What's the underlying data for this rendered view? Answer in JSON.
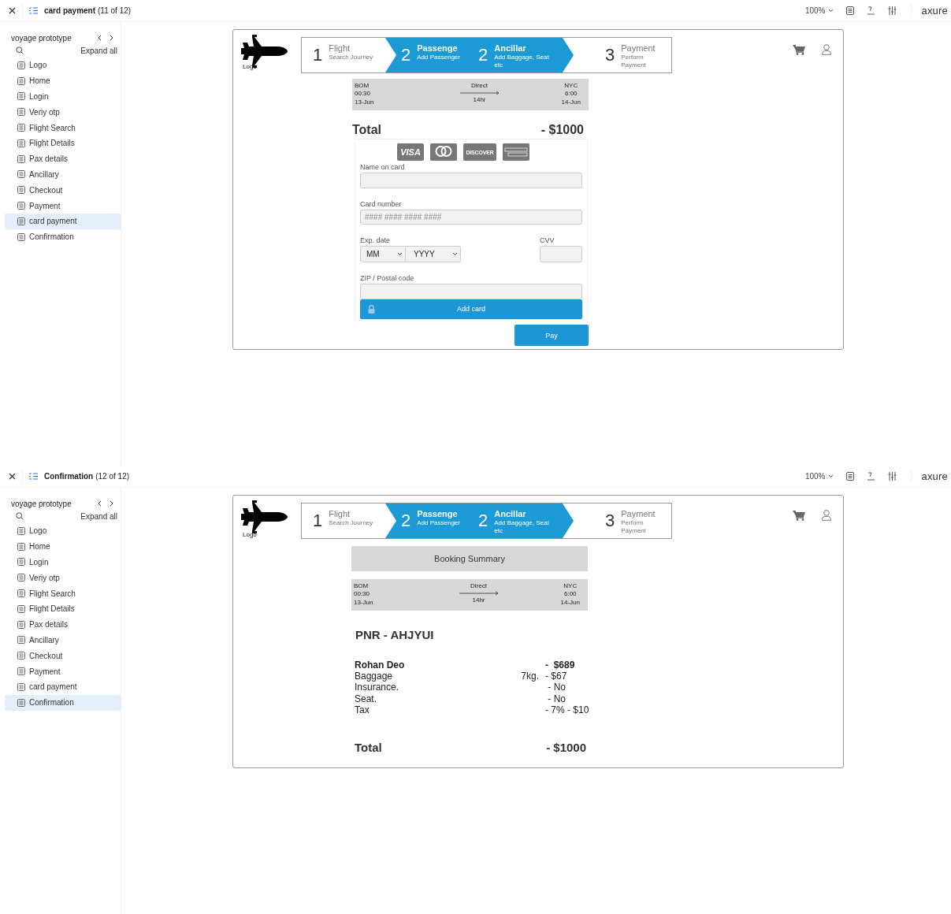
{
  "screens": [
    {
      "kind": "card_payment",
      "toolbar": {
        "page_title": "card payment",
        "page_count": "(11 of 12)",
        "zoom": "100%",
        "brand": "axure"
      },
      "sidebar": {
        "project": "voyage prototype",
        "expand_all": "Expand all",
        "pages": [
          {
            "label": "Logo",
            "selected": false
          },
          {
            "label": "Home",
            "selected": false
          },
          {
            "label": "Login",
            "selected": false
          },
          {
            "label": "Veriy otp",
            "selected": false
          },
          {
            "label": "Flight Search",
            "selected": false
          },
          {
            "label": "Flight Details",
            "selected": false
          },
          {
            "label": "Pax details",
            "selected": false
          },
          {
            "label": "Ancillary",
            "selected": false
          },
          {
            "label": "Checkout",
            "selected": false
          },
          {
            "label": "Payment",
            "selected": false
          },
          {
            "label": "card payment",
            "selected": true
          },
          {
            "label": "Confirmation",
            "selected": false
          }
        ]
      },
      "header": {
        "logo_label": "Logo",
        "steps": [
          {
            "number": "1",
            "title": "Flight",
            "subtitle": "Search Journey",
            "active": false
          },
          {
            "number": "2",
            "title": "Passenge",
            "subtitle": "Add Passenger",
            "active": true
          },
          {
            "number": "2",
            "title": "Ancillar",
            "subtitle": "Add Baggage, Seat etc",
            "active": true
          },
          {
            "number": "3",
            "title": "Payment",
            "subtitle": "Perform Payment",
            "active": false
          }
        ]
      },
      "flight": {
        "from": "BOM",
        "depart_time": "00:30",
        "depart_date": "13-Jun",
        "type": "Direct",
        "duration": "14hr",
        "to": "NYC",
        "arrive_time": "6:00",
        "arrive_date": "14-Jun"
      },
      "total": {
        "label": "Total",
        "amount": "- $1000"
      },
      "card_form": {
        "brands": [
          {
            "kind": "visa",
            "label": "VISA"
          },
          {
            "kind": "mastercard"
          },
          {
            "kind": "discover",
            "label": "DISCOVER"
          },
          {
            "kind": "amex"
          }
        ],
        "name_label": "Name on card",
        "number_label": "Card number",
        "number_placeholder": "#### #### #### ####",
        "expiry_label": "Exp. date",
        "month": "MM",
        "year": "YYYY",
        "cvv_label": "CVV",
        "zip_label": "ZIP / Postal code",
        "add_button": "Add card"
      },
      "pay_button": "Pay"
    },
    {
      "kind": "confirmation",
      "toolbar": {
        "page_title": "Confirmation",
        "page_count": "(12 of 12)",
        "zoom": "100%",
        "brand": "axure"
      },
      "sidebar": {
        "project": "voyage prototype",
        "expand_all": "Expand all",
        "pages": [
          {
            "label": "Logo",
            "selected": false
          },
          {
            "label": "Home",
            "selected": false
          },
          {
            "label": "Login",
            "selected": false
          },
          {
            "label": "Veriy otp",
            "selected": false
          },
          {
            "label": "Flight Search",
            "selected": false
          },
          {
            "label": "Flight Details",
            "selected": false
          },
          {
            "label": "Pax details",
            "selected": false
          },
          {
            "label": "Ancillary",
            "selected": false
          },
          {
            "label": "Checkout",
            "selected": false
          },
          {
            "label": "Payment",
            "selected": false
          },
          {
            "label": "card payment",
            "selected": false
          },
          {
            "label": "Confirmation",
            "selected": true
          }
        ]
      },
      "header": {
        "logo_label": "Logo",
        "steps": [
          {
            "number": "1",
            "title": "Flight",
            "subtitle": "Search Journey",
            "active": false
          },
          {
            "number": "2",
            "title": "Passenge",
            "subtitle": "Add Passenger",
            "active": true
          },
          {
            "number": "2",
            "title": "Ancillar",
            "subtitle": "Add Baggage, Seat etc",
            "active": true
          },
          {
            "number": "3",
            "title": "Payment",
            "subtitle": "Perform Payment",
            "active": false
          }
        ]
      },
      "summary_title": "Booking Summary",
      "flight": {
        "from": "BOM",
        "depart_time": "00:30",
        "depart_date": "13-Jun",
        "type": "Direct",
        "duration": "14hr",
        "to": "NYC",
        "arrive_time": "6:00",
        "arrive_date": "14-Jun"
      },
      "pnr": "PNR - AHJYUI",
      "lines": [
        {
          "label": "Rohan Deo",
          "amount": "-  $689",
          "bold": true
        },
        {
          "label": "Baggage",
          "detail": "7kg.",
          "amount": "- $67",
          "bold": false
        },
        {
          "label": "Insurance.",
          "amount": " - No",
          "bold": false
        },
        {
          "label": "Seat.",
          "amount": " - No",
          "bold": false
        },
        {
          "label": "Tax",
          "amount": "- 7% - $10",
          "bold": false
        }
      ],
      "total": {
        "label": "Total",
        "amount": "- $1000"
      }
    }
  ]
}
